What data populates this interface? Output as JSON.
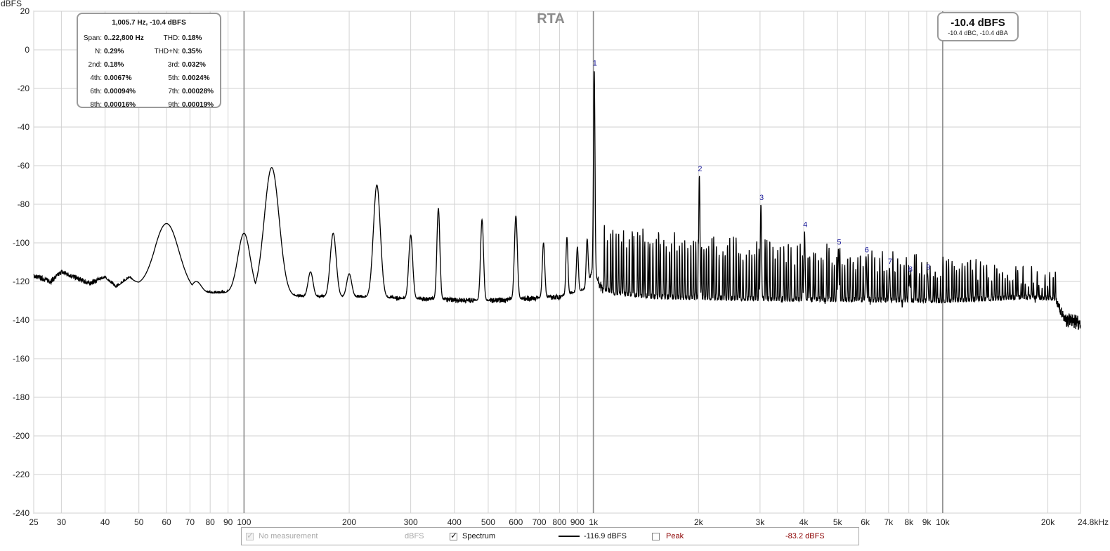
{
  "chart_data": {
    "type": "line",
    "title": "RTA",
    "ylabel": "dBFS",
    "xscale": "log",
    "xlim": [
      25,
      24800
    ],
    "ylim": [
      -240,
      20
    ],
    "grid": true,
    "x_ticks": [
      {
        "v": 25,
        "label": "25"
      },
      {
        "v": 30,
        "label": "30"
      },
      {
        "v": 40,
        "label": "40"
      },
      {
        "v": 50,
        "label": "50"
      },
      {
        "v": 60,
        "label": "60"
      },
      {
        "v": 70,
        "label": "70"
      },
      {
        "v": 80,
        "label": "80"
      },
      {
        "v": 90,
        "label": "90"
      },
      {
        "v": 100,
        "label": "100"
      },
      {
        "v": 200,
        "label": "200"
      },
      {
        "v": 300,
        "label": "300"
      },
      {
        "v": 400,
        "label": "400"
      },
      {
        "v": 500,
        "label": "500"
      },
      {
        "v": 600,
        "label": "600"
      },
      {
        "v": 700,
        "label": "700"
      },
      {
        "v": 800,
        "label": "800"
      },
      {
        "v": 900,
        "label": "900"
      },
      {
        "v": 1000,
        "label": "1k"
      },
      {
        "v": 2000,
        "label": "2k"
      },
      {
        "v": 3000,
        "label": "3k"
      },
      {
        "v": 4000,
        "label": "4k"
      },
      {
        "v": 5000,
        "label": "5k"
      },
      {
        "v": 6000,
        "label": "6k"
      },
      {
        "v": 7000,
        "label": "7k"
      },
      {
        "v": 8000,
        "label": "8k"
      },
      {
        "v": 9000,
        "label": "9k"
      },
      {
        "v": 10000,
        "label": "10k"
      },
      {
        "v": 20000,
        "label": "20k"
      },
      {
        "v": 24800,
        "label": "24.8kHz"
      }
    ],
    "y_ticks": [
      20,
      0,
      -20,
      -40,
      -60,
      -80,
      -100,
      -120,
      -140,
      -160,
      -180,
      -200,
      -220,
      -240
    ],
    "series": [
      {
        "name": "Spectrum",
        "color": "#000000",
        "floor": [
          [
            25,
            -117
          ],
          [
            28,
            -120
          ],
          [
            30,
            -115
          ],
          [
            33,
            -118
          ],
          [
            36,
            -121
          ],
          [
            40,
            -118
          ],
          [
            43,
            -123
          ],
          [
            47,
            -118
          ],
          [
            50,
            -123
          ],
          [
            55,
            -126
          ],
          [
            58,
            -124
          ],
          [
            65,
            -126
          ],
          [
            75,
            -126
          ],
          [
            90,
            -126
          ],
          [
            110,
            -127
          ],
          [
            150,
            -128
          ],
          [
            200,
            -128
          ],
          [
            300,
            -129
          ],
          [
            500,
            -130
          ],
          [
            800,
            -128
          ],
          [
            950,
            -124
          ],
          [
            980,
            -118
          ],
          [
            1000,
            -112
          ],
          [
            1020,
            -118
          ],
          [
            1060,
            -124
          ],
          [
            1150,
            -127
          ],
          [
            1500,
            -129
          ],
          [
            3000,
            -130
          ],
          [
            10000,
            -131
          ],
          [
            18000,
            -129
          ],
          [
            21000,
            -130
          ],
          [
            22500,
            -140
          ],
          [
            24800,
            -141
          ]
        ],
        "peaks": [
          {
            "f": 60,
            "db": -90,
            "w": 0.05
          },
          {
            "f": 73,
            "db": -120,
            "w": 0.02
          },
          {
            "f": 100,
            "db": -95,
            "w": 0.025
          },
          {
            "f": 120,
            "db": -61,
            "w": 0.03
          },
          {
            "f": 155,
            "db": -115,
            "w": 0.01
          },
          {
            "f": 180,
            "db": -95,
            "w": 0.012
          },
          {
            "f": 200,
            "db": -116,
            "w": 0.01
          },
          {
            "f": 240,
            "db": -70,
            "w": 0.014
          },
          {
            "f": 300,
            "db": -96,
            "w": 0.008
          },
          {
            "f": 360,
            "db": -82,
            "w": 0.006
          },
          {
            "f": 480,
            "db": -88,
            "w": 0.006
          },
          {
            "f": 600,
            "db": -86,
            "w": 0.006
          },
          {
            "f": 720,
            "db": -100,
            "w": 0.005
          },
          {
            "f": 840,
            "db": -97,
            "w": 0.004
          },
          {
            "f": 900,
            "db": -102,
            "w": 0.004
          },
          {
            "f": 960,
            "db": -98,
            "w": 0.004
          },
          {
            "f": 1005.7,
            "db": -10.4,
            "w": 0.003
          },
          {
            "f": 2011,
            "db": -65,
            "w": 0.0025
          },
          {
            "f": 3017,
            "db": -80,
            "w": 0.0025
          },
          {
            "f": 4023,
            "db": -94,
            "w": 0.0025
          },
          {
            "f": 5028,
            "db": -103,
            "w": 0.0025
          },
          {
            "f": 6034,
            "db": -107,
            "w": 0.0025
          },
          {
            "f": 7040,
            "db": -113,
            "w": 0.0025
          },
          {
            "f": 8046,
            "db": -117,
            "w": 0.0025
          },
          {
            "f": 9051,
            "db": -116,
            "w": 0.0025
          }
        ],
        "spur_region": [
          1080,
          21000
        ],
        "spur_count": 170,
        "spur_top_start": -95,
        "spur_top_end": -118
      }
    ],
    "harmonic_markers": [
      {
        "label": "1",
        "f": 1005.7,
        "db": -10.4
      },
      {
        "label": "2",
        "f": 2011,
        "db": -65
      },
      {
        "label": "3",
        "f": 3017,
        "db": -80
      },
      {
        "label": "4",
        "f": 4023,
        "db": -94
      },
      {
        "label": "5",
        "f": 5028,
        "db": -103
      },
      {
        "label": "6",
        "f": 6034,
        "db": -107
      },
      {
        "label": "7",
        "f": 7040,
        "db": -113
      },
      {
        "label": "8",
        "f": 8046,
        "db": -117
      },
      {
        "label": "9",
        "f": 9051,
        "db": -116
      }
    ]
  },
  "info_box": {
    "header": "1,005.7 Hz, -10.4 dBFS",
    "rows": [
      {
        "l1": "Span:",
        "v1": "0..22,800 Hz",
        "l2": "THD:",
        "v2": "0.18%"
      },
      {
        "l1": "N:",
        "v1": "0.29%",
        "l2": "THD+N:",
        "v2": "0.35%"
      },
      {
        "l1": "2nd:",
        "v1": "0.18%",
        "l2": "3rd:",
        "v2": "0.032%"
      },
      {
        "l1": "4th:",
        "v1": "0.0067%",
        "l2": "5th:",
        "v2": "0.0024%"
      },
      {
        "l1": "6th:",
        "v1": "0.00094%",
        "l2": "7th:",
        "v2": "0.00028%"
      },
      {
        "l1": "8th:",
        "v1": "0.00016%",
        "l2": "9th:",
        "v2": "0.00019%"
      }
    ]
  },
  "level_box": {
    "main": "-10.4 dBFS",
    "sub": "-10.4 dBC, -10.4 dBA"
  },
  "legend": {
    "no_measurement": {
      "label": "No measurement",
      "unit": "dBFS",
      "checked": true,
      "enabled": false
    },
    "spectrum": {
      "label": "Spectrum",
      "value": "-116.9 dBFS",
      "checked": true,
      "color": "#000000"
    },
    "peak": {
      "label": "Peak",
      "value": "-83.2 dBFS",
      "checked": false,
      "color": "#8b0000"
    }
  }
}
